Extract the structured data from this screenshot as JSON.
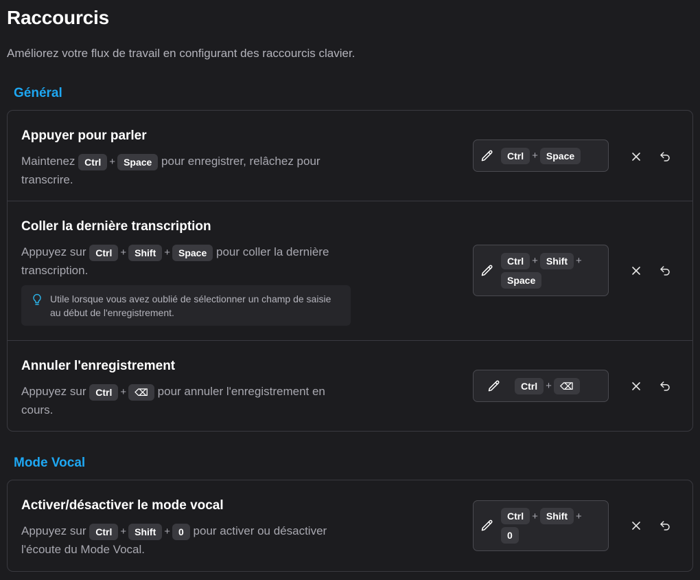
{
  "page": {
    "title": "Raccourcis",
    "subtitle": "Améliorez votre flux de travail en configurant des raccourcis clavier."
  },
  "sections": [
    {
      "title": "Général",
      "rows": [
        {
          "title": "Appuyer pour parler",
          "desc_before": "Maintenez",
          "keys": [
            "Ctrl",
            "Space"
          ],
          "desc_after": "pour enregistrer, relâchez pour transcrire.",
          "binding": [
            "Ctrl",
            "Space"
          ]
        },
        {
          "title": "Coller la dernière transcription",
          "desc_before": "Appuyez sur",
          "keys": [
            "Ctrl",
            "Shift",
            "Space"
          ],
          "desc_after": "pour coller la dernière transcription.",
          "tip": "Utile lorsque vous avez oublié de sélectionner un champ de saisie au début de l'enregistrement.",
          "binding": [
            "Ctrl",
            "Shift",
            "Space"
          ]
        },
        {
          "title": "Annuler l'enregistrement",
          "desc_before": "Appuyez sur",
          "keys": [
            "Ctrl",
            "⌫"
          ],
          "desc_after": "pour annuler l'enregistrement en cours.",
          "binding": [
            "Ctrl",
            "⌫"
          ]
        }
      ]
    },
    {
      "title": "Mode Vocal",
      "rows": [
        {
          "title": "Activer/désactiver le mode vocal",
          "desc_before": "Appuyez sur",
          "keys": [
            "Ctrl",
            "Shift",
            "0"
          ],
          "desc_after": "pour activer ou désactiver l'écoute du Mode Vocal.",
          "binding": [
            "Ctrl",
            "Shift",
            "0"
          ]
        }
      ]
    }
  ],
  "plus_sign": "+",
  "icons": {
    "edit": "pencil-icon",
    "clear": "close-icon",
    "reset": "undo-icon",
    "tip": "lightbulb-icon"
  },
  "colors": {
    "accent": "#1ea7f2",
    "background": "#1c1c1f",
    "tip_icon": "#2bb3e8"
  }
}
